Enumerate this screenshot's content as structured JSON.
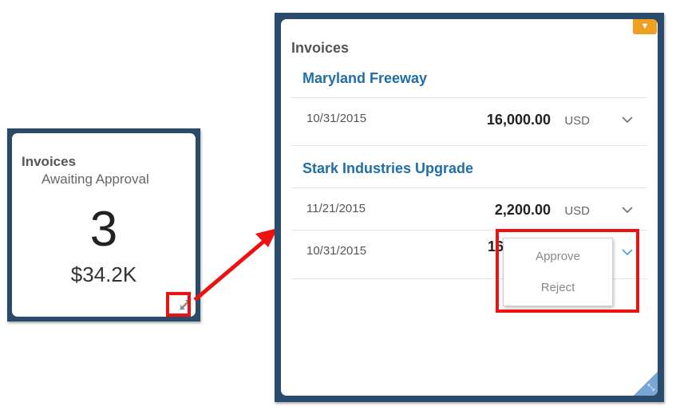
{
  "small_tile": {
    "title": "Invoices",
    "subtitle": "Awaiting Approval",
    "count": "3",
    "amount": "$34.2K",
    "expand_icon": "expand-arrows-icon"
  },
  "expanded_tile": {
    "title": "Invoices",
    "menu_tab_icon": "caret-down-icon",
    "groups": [
      {
        "heading": "Maryland Freeway",
        "rows": [
          {
            "date": "10/31/2015",
            "amount": "16,000.00",
            "currency": "USD"
          }
        ]
      },
      {
        "heading": "Stark Industries Upgrade",
        "rows": [
          {
            "date": "11/21/2015",
            "amount": "2,200.00",
            "currency": "USD"
          },
          {
            "date": "10/31/2015",
            "amount": "16",
            "currency": ""
          }
        ]
      }
    ],
    "action_menu": {
      "items": [
        "Approve",
        "Reject"
      ]
    },
    "collapse_icon": "collapse-arrows-icon"
  },
  "colors": {
    "frame": "#2a4a6a",
    "heading_blue": "#1f6ea8",
    "highlight_red": "#ee1111",
    "orange_tab": "#f0a020"
  }
}
